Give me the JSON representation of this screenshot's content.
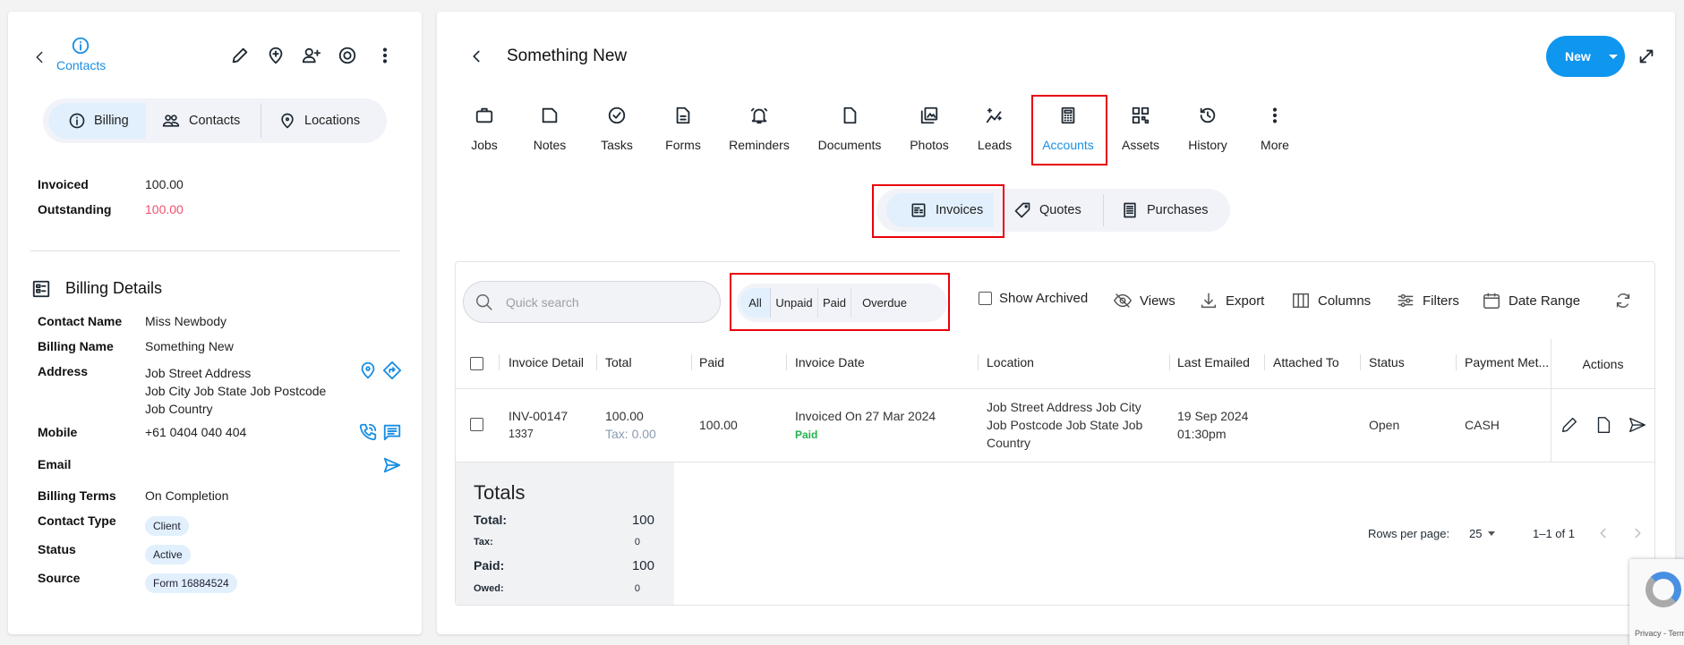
{
  "left": {
    "header_label": "Contacts",
    "tabs": [
      {
        "label": "Billing"
      },
      {
        "label": "Contacts"
      },
      {
        "label": "Locations"
      }
    ],
    "summary": [
      {
        "label": "Invoiced",
        "value": "100.00"
      },
      {
        "label": "Outstanding",
        "value": "100.00"
      }
    ],
    "billing_title": "Billing Details",
    "details": {
      "contact_name": {
        "label": "Contact Name",
        "value": "Miss Newbody"
      },
      "billing_name": {
        "label": "Billing Name",
        "value": "Something New"
      },
      "address": {
        "label": "Address",
        "lines": [
          "Job Street Address",
          "Job City Job State Job Postcode",
          "Job Country"
        ]
      },
      "mobile": {
        "label": "Mobile",
        "value": "+61 0404 040 404"
      },
      "email": {
        "label": "Email"
      },
      "billing_terms": {
        "label": "Billing Terms",
        "value": "On Completion"
      },
      "contact_type": {
        "label": "Contact Type",
        "value": "Client"
      },
      "status": {
        "label": "Status",
        "value": "Active"
      },
      "source": {
        "label": "Source",
        "value": "Form 16884524"
      }
    }
  },
  "main": {
    "title": "Something New",
    "new_button": "New",
    "tabs": [
      {
        "label": "Jobs"
      },
      {
        "label": "Notes"
      },
      {
        "label": "Tasks"
      },
      {
        "label": "Forms"
      },
      {
        "label": "Reminders"
      },
      {
        "label": "Documents"
      },
      {
        "label": "Photos"
      },
      {
        "label": "Leads"
      },
      {
        "label": "Accounts"
      },
      {
        "label": "Assets"
      },
      {
        "label": "History"
      },
      {
        "label": "More"
      }
    ],
    "subtabs": [
      {
        "label": "Invoices"
      },
      {
        "label": "Quotes"
      },
      {
        "label": "Purchases"
      }
    ],
    "search_placeholder": "Quick search",
    "filters": [
      {
        "label": "All"
      },
      {
        "label": "Unpaid"
      },
      {
        "label": "Paid"
      },
      {
        "label": "Overdue"
      }
    ],
    "toolbar": {
      "show_archived": "Show Archived",
      "views": "Views",
      "export": "Export",
      "columns": "Columns",
      "filters": "Filters",
      "date_range": "Date Range"
    },
    "columns": [
      "Invoice Detail",
      "Total",
      "Paid",
      "Invoice Date",
      "Location",
      "Last Emailed",
      "Attached To",
      "Status",
      "Payment Met...",
      "Actions"
    ],
    "rows": [
      {
        "number": "INV-00147",
        "ref": "1337",
        "total": "100.00",
        "tax": "Tax: 0.00",
        "paid": "100.00",
        "invoice_date": "Invoiced On 27 Mar 2024",
        "paid_status": "Paid",
        "location": [
          "Job Street Address Job City",
          "Job Postcode Job State Job",
          "Country"
        ],
        "last_emailed": [
          "19 Sep 2024",
          "01:30pm"
        ],
        "attached_to": "",
        "status": "Open",
        "payment_method": "CASH"
      }
    ],
    "totals": {
      "title": "Totals",
      "total_label": "Total:",
      "total": "100",
      "tax_label": "Tax:",
      "tax": "0",
      "paid_label": "Paid:",
      "paid": "100",
      "owed_label": "Owed:",
      "owed": "0"
    },
    "pagination": {
      "rows_per_page_label": "Rows per page:",
      "rows_per_page": "25",
      "range": "1–1 of 1"
    },
    "recaptcha": "Privacy - Terms"
  },
  "colors": {
    "accent": "#1a8fe3",
    "danger": "#f0506e",
    "success": "#22b14c"
  }
}
